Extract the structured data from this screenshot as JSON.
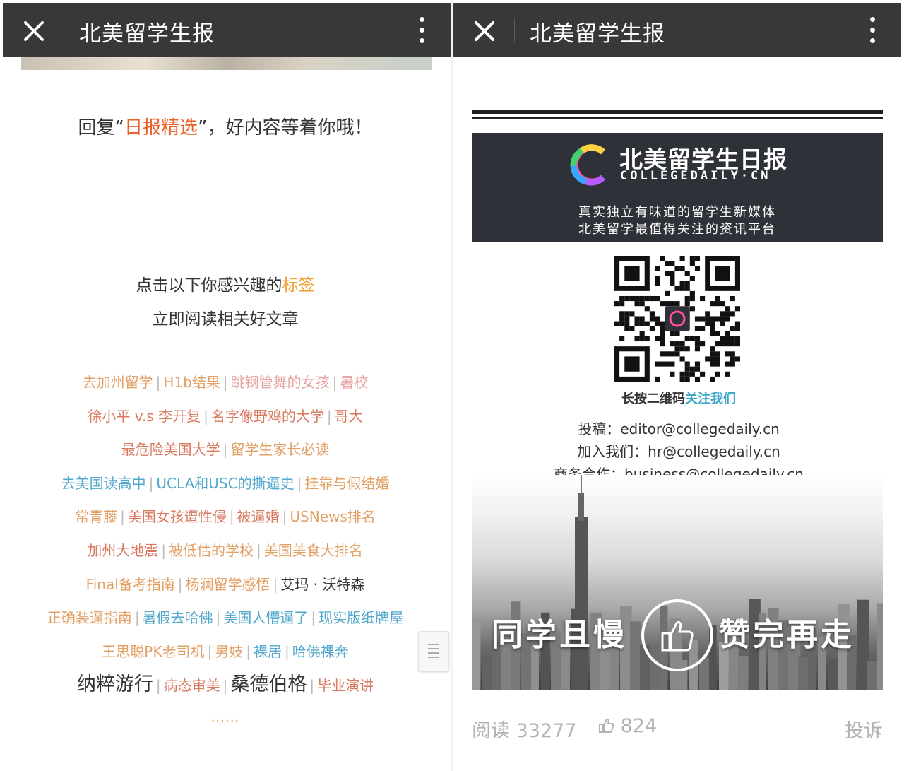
{
  "left": {
    "titlebar": {
      "title": "北美留学生报"
    },
    "reply": {
      "before": "回复“",
      "keyword": "日报精选",
      "after": "”，好内容等着你哦！"
    },
    "intro": {
      "line1_before": "点击以下你感兴趣的",
      "line1_hl": "标签",
      "line2": "立即阅读相关好文章"
    },
    "tag_rows": [
      [
        {
          "t": "去加州留学",
          "c": "#e2a065"
        },
        {
          "t": "H1b结果",
          "c": "#e2a065"
        },
        {
          "t": "跳钢管舞的女孩",
          "c": "#e8a4a0"
        },
        {
          "t": "暑校",
          "c": "#e8a4a0"
        }
      ],
      [
        {
          "t": "徐小平 v.s 李开复",
          "c": "#d9785f"
        },
        {
          "t": "名字像野鸡的大学",
          "c": "#d9785f"
        },
        {
          "t": "哥大",
          "c": "#d9785f"
        }
      ],
      [
        {
          "t": "最危险美国大学",
          "c": "#d9785f"
        },
        {
          "t": "留学生家长必读",
          "c": "#e2a065"
        }
      ],
      [
        {
          "t": "去美国读高中",
          "c": "#52a8cc"
        },
        {
          "t": "UCLA和USC的撕逼史",
          "c": "#52a8cc"
        },
        {
          "t": "挂靠与假结婚",
          "c": "#e2a065"
        }
      ],
      [
        {
          "t": "常青藤",
          "c": "#e2a065"
        },
        {
          "t": "美国女孩遭性侵",
          "c": "#d9785f"
        },
        {
          "t": "被逼婚",
          "c": "#d9785f"
        },
        {
          "t": "USNews排名",
          "c": "#e2a065"
        }
      ],
      [
        {
          "t": "加州大地震",
          "c": "#d9785f"
        },
        {
          "t": "被低估的学校",
          "c": "#e2a065"
        },
        {
          "t": "美国美食大排名",
          "c": "#e2a065"
        }
      ],
      [
        {
          "t": "Final备考指南",
          "c": "#e2a065"
        },
        {
          "t": "杨澜留学感悟",
          "c": "#e2a065"
        },
        {
          "t": "艾玛 · 沃特森",
          "c": "#333333"
        }
      ],
      [
        {
          "t": "正确装逼指南",
          "c": "#e2a065"
        },
        {
          "t": "暑假去哈佛",
          "c": "#52a8cc"
        },
        {
          "t": "美国人懵逼了",
          "c": "#52a8cc"
        },
        {
          "t": "现实版纸牌屋",
          "c": "#52a8cc"
        }
      ],
      [
        {
          "t": "王思聪PK老司机",
          "c": "#e2a065"
        },
        {
          "t": "男妓",
          "c": "#e2a065"
        },
        {
          "t": "裸居",
          "c": "#52a8cc"
        },
        {
          "t": "哈佛裸奔",
          "c": "#52a8cc"
        }
      ]
    ],
    "tag_last_row": [
      {
        "t": "纳粹游行",
        "c": "#333333",
        "big": true
      },
      {
        "t": "病态审美",
        "c": "#d9785f",
        "big": false
      },
      {
        "t": "桑德伯格",
        "c": "#333333",
        "big": true
      },
      {
        "t": "毕业演讲",
        "c": "#d9785f",
        "big": false
      }
    ],
    "ellipsis": "......"
  },
  "right": {
    "titlebar": {
      "title": "北美留学生报"
    },
    "banner": {
      "brand": "北美留学生日报",
      "domain": "COLLEGEDAILY·CN",
      "slogan1": "真实独立有味道的留学生新媒体",
      "slogan2": "北美留学最值得关注的资讯平台"
    },
    "qr_caption": {
      "before": "长按二维码",
      "hl": "关注我们"
    },
    "contacts": [
      "投稿：editor@collegedaily.cn",
      "加入我们：hr@collegedaily.cn",
      "商务合作：business@collegedaily.cn"
    ],
    "cta": {
      "left": "同学且慢",
      "right": "赞完再走"
    },
    "footer": {
      "read": "阅读 33277",
      "likes": "824",
      "report": "投诉"
    }
  },
  "colors": {
    "titlebar": "#38383b",
    "orange": "#e8632c",
    "teal": "#38a5c9",
    "banner": "#2e3138"
  },
  "icons": [
    "close-icon",
    "more-vertical-icon",
    "thumbs-up-icon",
    "scroll-handle-icon",
    "qr-code-image",
    "logo-c-icon"
  ]
}
